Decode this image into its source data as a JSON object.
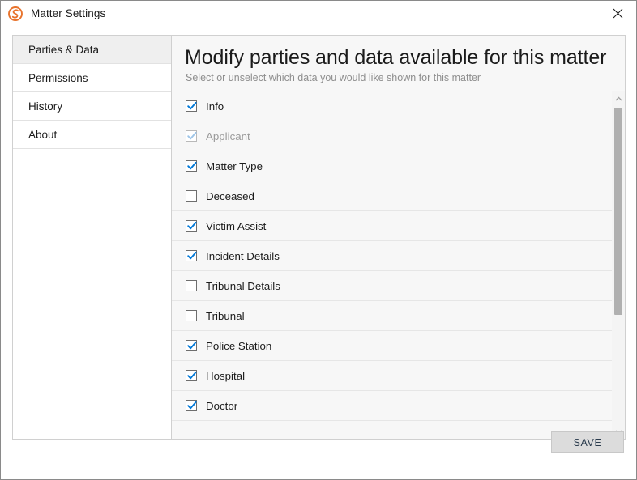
{
  "window": {
    "title": "Matter Settings",
    "logo_icon": "swirl-logo-icon",
    "logo_color": "#E8732C",
    "close_icon": "close-icon"
  },
  "sidebar": {
    "items": [
      {
        "label": "Parties & Data",
        "selected": true
      },
      {
        "label": "Permissions",
        "selected": false
      },
      {
        "label": "History",
        "selected": false
      },
      {
        "label": "About",
        "selected": false
      }
    ]
  },
  "content": {
    "heading": "Modify parties and data available for this matter",
    "subheading": "Select or unselect which data you would like shown for this matter",
    "checkbox_accent": "#0078D7",
    "items": [
      {
        "label": "Info",
        "checked": true,
        "disabled": false
      },
      {
        "label": "Applicant",
        "checked": true,
        "disabled": true
      },
      {
        "label": "Matter Type",
        "checked": true,
        "disabled": false
      },
      {
        "label": "Deceased",
        "checked": false,
        "disabled": false
      },
      {
        "label": "Victim Assist",
        "checked": true,
        "disabled": false
      },
      {
        "label": "Incident Details",
        "checked": true,
        "disabled": false
      },
      {
        "label": "Tribunal Details",
        "checked": false,
        "disabled": false
      },
      {
        "label": "Tribunal",
        "checked": false,
        "disabled": false
      },
      {
        "label": "Police Station",
        "checked": true,
        "disabled": false
      },
      {
        "label": "Hospital",
        "checked": true,
        "disabled": false
      },
      {
        "label": "Doctor",
        "checked": true,
        "disabled": false
      }
    ]
  },
  "scrollbar": {
    "up_arrow_icon": "chevron-up-icon",
    "down_arrow_icon": "chevron-down-icon"
  },
  "footer": {
    "save_label": "SAVE"
  }
}
